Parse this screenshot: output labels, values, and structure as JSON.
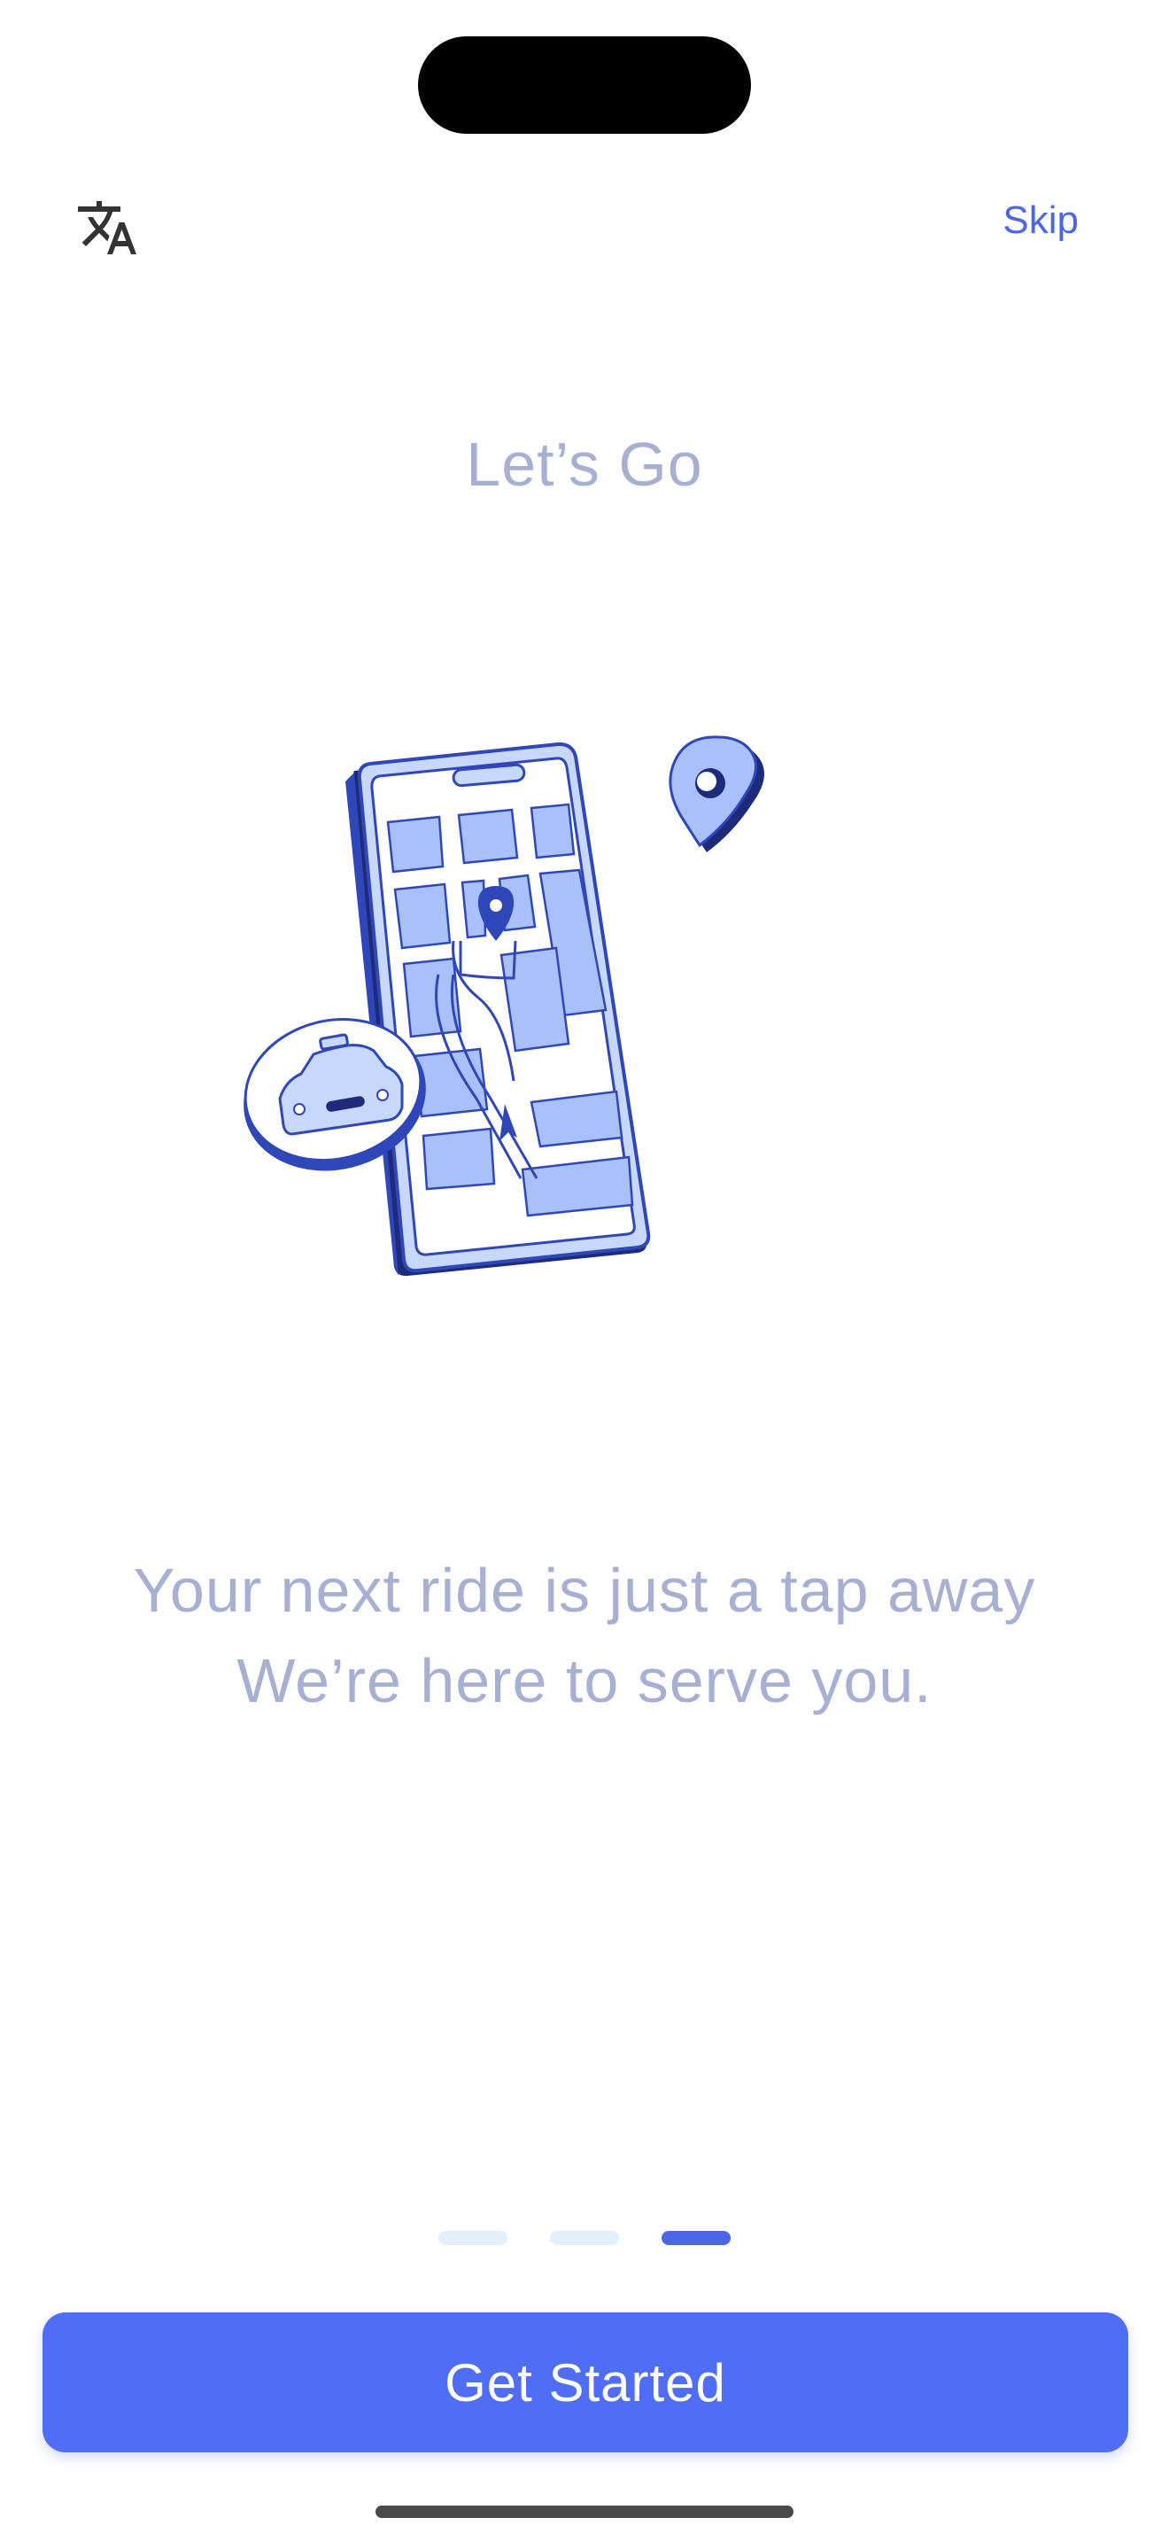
{
  "header": {
    "translate_icon": "translate-icon",
    "skip_label": "Skip"
  },
  "main": {
    "title": "Let’s Go",
    "illustration_icon": "phone-map-navigation-illustration",
    "subtitle_line1": "Your next ride is just a tap away",
    "subtitle_line2": "We’re here to serve you."
  },
  "pager": {
    "total_pages": 3,
    "active_page": 3
  },
  "footer": {
    "cta_label": "Get Started"
  },
  "colors": {
    "accent": "#4f6df5",
    "link": "#4b66e8",
    "muted_text": "#a7b0d3",
    "inactive_dot": "#e3f0fb",
    "illustration_fill": "#a9c0fb",
    "illustration_dark": "#2f47b8"
  }
}
